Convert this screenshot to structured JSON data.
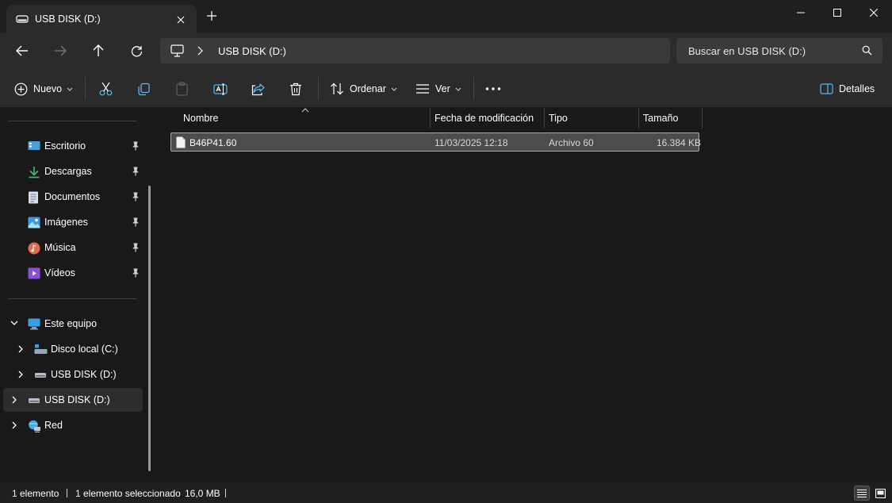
{
  "window": {
    "tab_title": "USB DISK (D:)",
    "controls": [
      "minimize",
      "maximize",
      "close"
    ]
  },
  "address": {
    "breadcrumb": "USB DISK (D:)",
    "search_placeholder": "Buscar en USB DISK (D:)"
  },
  "toolbar": {
    "new_label": "Nuevo",
    "sort_label": "Ordenar",
    "view_label": "Ver",
    "details_label": "Detalles"
  },
  "sidebar": {
    "quick_access": [
      {
        "label": "Escritorio",
        "icon": "desktop-icon"
      },
      {
        "label": "Descargas",
        "icon": "download-icon"
      },
      {
        "label": "Documentos",
        "icon": "documents-icon"
      },
      {
        "label": "Imágenes",
        "icon": "pictures-icon"
      },
      {
        "label": "Música",
        "icon": "music-icon"
      },
      {
        "label": "Vídeos",
        "icon": "videos-icon"
      }
    ],
    "this_pc": "Este equipo",
    "local_disk": "Disco local (C:)",
    "usb_child": "USB DISK (D:)",
    "usb_root": "USB DISK (D:)",
    "network": "Red"
  },
  "file_list": {
    "columns": [
      "Nombre",
      "Fecha de modificación",
      "Tipo",
      "Tamaño"
    ],
    "rows": [
      {
        "name": "B46P41.60",
        "modified": "11/03/2025 12:18",
        "type": "Archivo 60",
        "size": "16.384 KB"
      }
    ]
  },
  "status": {
    "count": "1 elemento",
    "selected": "1 elemento seleccionado",
    "size": "16,0 MB"
  },
  "colors": {
    "background": "#191919",
    "toolbar": "#2b2b2b",
    "selection": "#4c4c4c",
    "accent": "#4cc2ff"
  }
}
